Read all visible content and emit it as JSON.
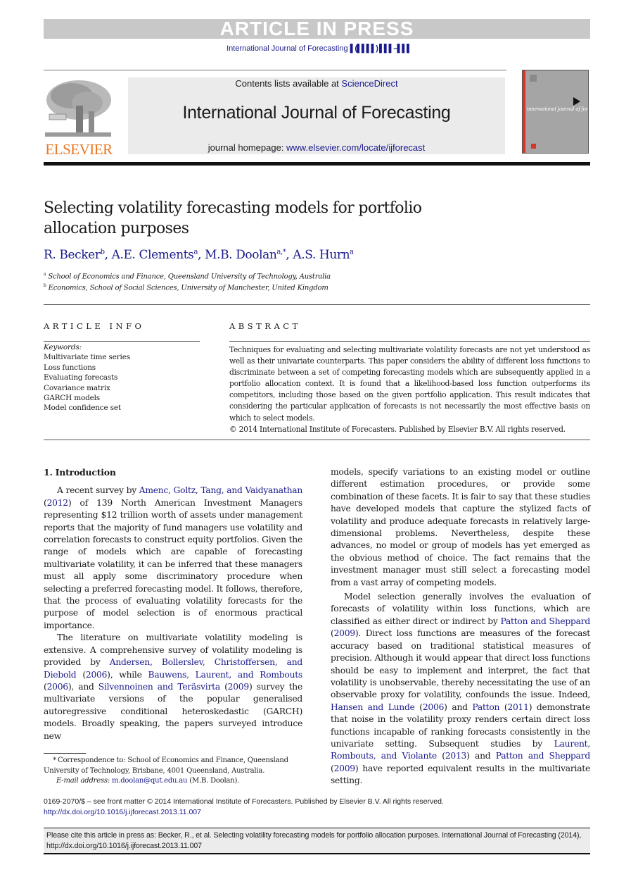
{
  "banner": {
    "text": "ARTICLE IN PRESS"
  },
  "running_head": {
    "journal": "International Journal of Forecasting",
    "volume_placeholder": "▌(▌▌▌▌) ▌▌▌–▌▌▌"
  },
  "header": {
    "publisher_logo_label": "ELSEVIER",
    "contents_prefix": "Contents lists available at ",
    "contents_link": "ScienceDirect",
    "journal_name": "International Journal of Forecasting",
    "homepage_prefix": "journal homepage: ",
    "homepage_link": "www.elsevier.com/locate/ijforecast",
    "cover_title": "international journal of forecasting"
  },
  "article": {
    "title": "Selecting volatility forecasting models for portfolio allocation purposes",
    "authors": [
      {
        "name": "R. Becker",
        "sup": "b"
      },
      {
        "name": "A.E. Clements",
        "sup": "a"
      },
      {
        "name": "M.B. Doolan",
        "sup": "a,*"
      },
      {
        "name": "A.S. Hurn",
        "sup": "a"
      }
    ],
    "affiliations": [
      {
        "key": "a",
        "text": "School of Economics and Finance, Queensland University of Technology, Australia"
      },
      {
        "key": "b",
        "text": "Economics, School of Social Sciences, University of Manchester, United Kingdom"
      }
    ]
  },
  "article_info": {
    "heading": "ARTICLE INFO",
    "keywords_label": "Keywords:",
    "keywords": [
      "Multivariate time series",
      "Loss functions",
      "Evaluating forecasts",
      "Covariance matrix",
      "GARCH models",
      "Model confidence set"
    ]
  },
  "abstract": {
    "heading": "ABSTRACT",
    "text": "Techniques for evaluating and selecting multivariate volatility forecasts are not yet understood as well as their univariate counterparts. This paper considers the ability of different loss functions to discriminate between a set of competing forecasting models which are subsequently applied in a portfolio allocation context. It is found that a likelihood-based loss function outperforms its competitors, including those based on the given portfolio application. This result indicates that considering the particular application of forecasts is not necessarily the most effective basis on which to select models.",
    "copyright": "© 2014 International Institute of Forecasters. Published by Elsevier B.V. All rights reserved."
  },
  "body": {
    "section_heading": "1.  Introduction",
    "p1": {
      "t1": "A recent survey by ",
      "l1": "Amenc, Goltz, Tang, and Vaidyanathan",
      "t2": " (",
      "l2": "2012",
      "t3": ") of 139 North American Investment Managers representing $12 trillion worth of assets under management reports that the majority of fund managers use volatility and correlation forecasts to construct equity portfolios. Given the range of models which are capable of forecasting multivariate volatility, it can be inferred that these managers must all apply some discriminatory procedure when selecting a preferred forecasting model. It follows, therefore, that the process of evaluating volatility forecasts for the purpose of model selection is of enormous practical importance."
    },
    "p2": {
      "t1": "The literature on multivariate volatility modeling is extensive. A comprehensive survey of volatility modeling is provided by ",
      "l1": "Andersen, Bollerslev, Christoffersen, and Diebold",
      "t2": " (",
      "l2": "2006",
      "t3": "), while ",
      "l3": "Bauwens, Laurent, and Rombouts",
      "t4": " (",
      "l4": "2006",
      "t5": "), and ",
      "l5": "Silvennoinen and Teräsvirta",
      "t6": " (",
      "l6": "2009",
      "t7": ") survey the multivariate versions of the popular generalised autoregressive conditional heteroskedastic (GARCH) models. Broadly speaking, the papers surveyed introduce new"
    },
    "p3": {
      "t1": "models, specify variations to an existing model or outline different estimation procedures, or provide some combination of these facets.  It is fair to say that these studies have developed models that capture the stylized facts of volatility and produce adequate forecasts in relatively large-dimensional problems. Nevertheless, despite these advances, no model or group of models has yet emerged as the obvious method of choice. The fact remains that the investment manager must still select a forecasting model from a vast array of competing models."
    },
    "p4": {
      "t1": "Model selection generally involves the evaluation of forecasts of volatility within loss functions, which are classified as either direct or indirect by ",
      "l1": "Patton and Sheppard",
      "t2": " (",
      "l2": "2009",
      "t3": "). Direct loss functions are measures of the forecast accuracy based on traditional statistical measures of precision. Although it would appear that direct loss functions should be easy to implement and interpret, the fact that volatility is unobservable, thereby necessitating the use of an observable proxy for volatility, confounds the issue. Indeed, ",
      "l3": "Hansen and Lunde",
      "t4": " (",
      "l4": "2006",
      "t5": ") and ",
      "l5": "Patton",
      "t6": " (",
      "l6": "2011",
      "t7": ") demonstrate that noise in the volatility proxy renders certain direct loss functions incapable of ranking forecasts consistently in the univariate setting. Subsequent studies by ",
      "l7": "Laurent, Rombouts, and Violante",
      "t8": " (",
      "l8": "2013",
      "t9": ") and ",
      "l9": "Patton and Sheppard",
      "t10": " (",
      "l10": "2009",
      "t11": ") have reported equivalent results in the multivariate setting."
    }
  },
  "footnote": {
    "star": "*",
    "text": "Correspondence to: School of Economics and Finance, Queensland University of Technology, Brisbane, 4001 Queensland, Australia.",
    "email_label": "E-mail address:",
    "email": "m.doolan@qut.edu.au",
    "email_suffix": " (M.B. Doolan)."
  },
  "front_matter": {
    "line1": "0169-2070/$ – see front matter © 2014 International Institute of Forecasters. Published by Elsevier B.V. All rights reserved.",
    "doi": "http://dx.doi.org/10.1016/j.ijforecast.2013.11.007"
  },
  "cite_box": {
    "text": "Please cite this article in press as: Becker, R., et al. Selecting volatility forecasting models for portfolio allocation purposes. International Journal of Forecasting (2014), http://dx.doi.org/10.1016/j.ijforecast.2013.11.007"
  },
  "colors": {
    "link": "#1a1a8c",
    "elsevier_orange": "#e87722",
    "banner_gray": "#c8c8c8"
  }
}
